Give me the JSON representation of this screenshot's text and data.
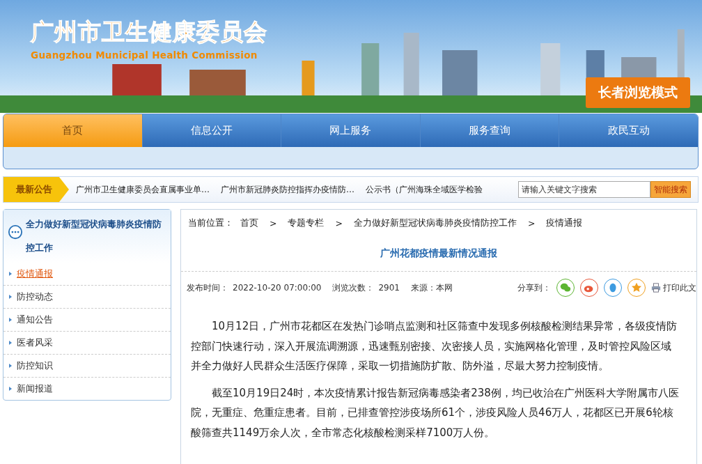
{
  "header": {
    "title": "广州市卫生健康委员会",
    "subtitle": "Guangzhou Municipal Health Commission",
    "elder_mode": "长者浏览模式"
  },
  "nav": [
    {
      "label": "首页",
      "selected": true
    },
    {
      "label": "信息公开",
      "selected": false
    },
    {
      "label": "网上服务",
      "selected": false
    },
    {
      "label": "服务查询",
      "selected": false
    },
    {
      "label": "政民互动",
      "selected": false
    }
  ],
  "notice": {
    "label": "最新公告",
    "items": [
      "广州市卫生健康委员会直属事业单…",
      "广州市新冠肺炎防控指挥办疫情防…",
      "公示书（广州海珠全域医学检验"
    ],
    "search_placeholder": "请输入关键文字搜索",
    "search_button": "智能搜索"
  },
  "sidebar": {
    "title": "全力做好新型冠状病毒肺炎疫情防控工作",
    "items": [
      {
        "label": "疫情通报",
        "selected": true
      },
      {
        "label": "防控动态",
        "selected": false
      },
      {
        "label": "通知公告",
        "selected": false
      },
      {
        "label": "医者风采",
        "selected": false
      },
      {
        "label": "防控知识",
        "selected": false
      },
      {
        "label": "新闻报道",
        "selected": false
      }
    ]
  },
  "breadcrumb": {
    "label": "当前位置：",
    "items": [
      "首页",
      "专题专栏",
      "全力做好新型冠状病毒肺炎疫情防控工作",
      "疫情通报"
    ],
    "separator": ">"
  },
  "article": {
    "title": "广州花都疫情最新情况通报",
    "published_label": "发布时间：",
    "published": "2022-10-20 07:00:00",
    "views_label": "浏览次数：",
    "views": "2901",
    "source_label": "来源：",
    "source": "本网",
    "share_label": "分享到：",
    "print": "打印此文",
    "paragraphs": [
      "10月12日，广州市花都区在发热门诊哨点监测和社区筛查中发现多例核酸检测结果异常，各级疫情防控部门快速行动，深入开展流调溯源，迅速甄别密接、次密接人员，实施网格化管理，及时管控风险区域并全力做好人民群众生活医疗保障，采取一切措施防扩散、防外溢，尽最大努力控制疫情。",
      "截至10月19日24时，本次疫情累计报告新冠病毒感染者238例，均已收治在广州医科大学附属市八医院，无重症、危重症患者。目前，已排查管控涉疫场所61个，涉疫风险人员46万人，花都区已开展6轮核酸筛查共1149万余人次，全市常态化核酸检测采样7100万人份。"
    ]
  }
}
